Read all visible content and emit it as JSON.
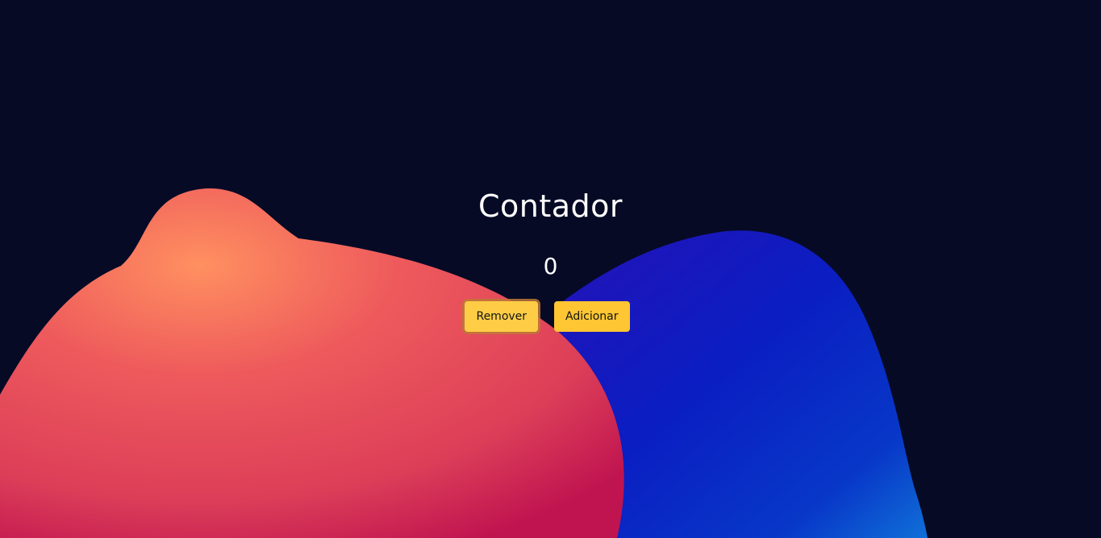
{
  "app": {
    "title": "Contador",
    "count": "0"
  },
  "buttons": {
    "remove_label": "Remover",
    "add_label": "Adicionar"
  },
  "colors": {
    "background": "#060a25",
    "button": "#fdc632",
    "blob_warm": "#f26b5a",
    "blob_cool": "#0a22c8"
  }
}
